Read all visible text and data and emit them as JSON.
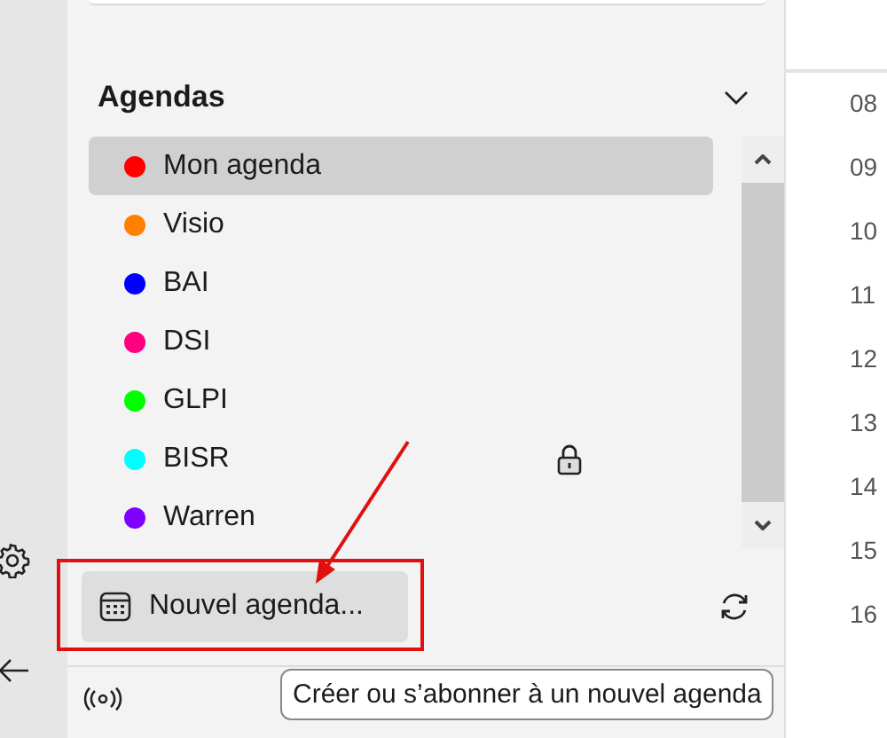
{
  "sidebar": {
    "section_title": "Agendas",
    "calendars": [
      {
        "name": "Mon agenda",
        "color": "#ff0000",
        "selected": true,
        "locked": false
      },
      {
        "name": "Visio",
        "color": "#ff8000",
        "selected": false,
        "locked": false
      },
      {
        "name": "BAI",
        "color": "#0000ff",
        "selected": false,
        "locked": false
      },
      {
        "name": "DSI",
        "color": "#ff0080",
        "selected": false,
        "locked": false
      },
      {
        "name": "GLPI",
        "color": "#00ff00",
        "selected": false,
        "locked": false
      },
      {
        "name": "BISR",
        "color": "#00ffff",
        "selected": false,
        "locked": true
      },
      {
        "name": "Warren",
        "color": "#8000ff",
        "selected": false,
        "locked": false
      }
    ],
    "new_button": "Nouvel agenda...",
    "tooltip": "Créer ou s’abonner à un nouvel agenda"
  },
  "hours": [
    "08",
    "09",
    "10",
    "11",
    "12",
    "13",
    "14",
    "15",
    "16"
  ]
}
